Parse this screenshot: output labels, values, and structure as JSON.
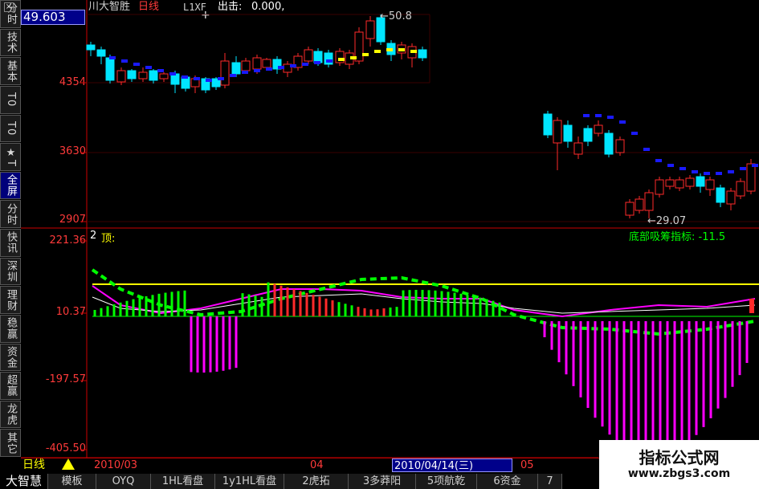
{
  "header": {
    "price_box": "49.603",
    "title": "川大智胜",
    "period": "日线",
    "indicator_name": "L1XF",
    "indicator_label": "出击:",
    "indicator_value": "0.000,"
  },
  "left_tabs": [
    "分时",
    "技术",
    "基本",
    "T0",
    "T0",
    "★T",
    "全屏",
    "分时",
    "快讯",
    "深圳",
    "理财",
    "稳赢",
    "资金",
    "超赢",
    "龙虎",
    "其它"
  ],
  "price_axis": {
    "labels": [
      "4354",
      "3630",
      "2907"
    ]
  },
  "indicator_axis": {
    "labels": [
      "221.36",
      "10.37",
      "-197.57",
      "-405.50"
    ]
  },
  "sub_header": {
    "index": "2",
    "label": "顶:"
  },
  "annotations": {
    "high_marker": "50.8",
    "low_marker": "29.07",
    "bottom_indicator": "底部吸筹指标: -11.5"
  },
  "date_bar": {
    "period_label": "日线",
    "dates": [
      "2010/03",
      "04",
      "2010/04/14(三)",
      "05"
    ]
  },
  "bottom_tabs": [
    "大智慧",
    "模板",
    "OYQ",
    "1HL看盘",
    "1y1HL看盘",
    "2虎拓",
    "3多莽阳",
    "5项航乾",
    "6资金",
    "7"
  ],
  "watermark": {
    "title": "指标公式网",
    "url": "www.zbgs3.com"
  },
  "colors": {
    "up": "#ff2a2a",
    "down": "#00e5ff",
    "yellow": "#ffff00",
    "blue": "#1a1aff",
    "magenta": "#ff00ff",
    "green": "#00ff00",
    "axis": "#cc0000"
  }
}
